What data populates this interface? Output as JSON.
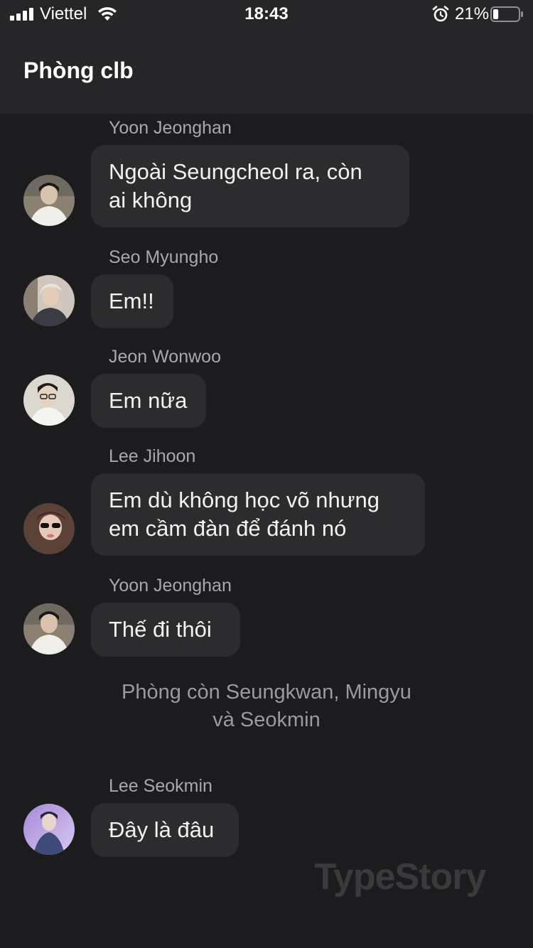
{
  "status_bar": {
    "carrier": "Viettel",
    "time": "18:43",
    "battery_percent": "21%",
    "battery_level": 0.21,
    "icons": [
      "signal-icon",
      "wifi-icon",
      "alarm-icon",
      "battery-icon"
    ]
  },
  "header": {
    "title": "Phòng clb"
  },
  "messages": [
    {
      "sender": "Yoon Jeonghan",
      "lines": [
        "Ngoài Seungcheol ra, còn",
        "ai không"
      ]
    },
    {
      "sender": "Seo Myungho",
      "lines": [
        "Em!!"
      ]
    },
    {
      "sender": "Jeon Wonwoo",
      "lines": [
        "Em nữa"
      ]
    },
    {
      "sender": "Lee Jihoon",
      "lines": [
        "Em dù không học võ nhưng",
        "em cầm đàn để đánh nó"
      ]
    },
    {
      "sender": "Yoon Jeonghan",
      "lines": [
        "Thế đi thôi"
      ]
    },
    {
      "sender": "Lee Seokmin",
      "lines": [
        "Đây là đâu"
      ]
    }
  ],
  "system_note": {
    "lines": [
      "Phòng còn Seungkwan, Mingyu",
      "và Seokmin"
    ]
  },
  "watermark": "TypeStory",
  "colors": {
    "background": "#1c1c1e",
    "header": "#262628",
    "bubble": "#2c2c2e",
    "sender_text": "#a8a8ad"
  }
}
